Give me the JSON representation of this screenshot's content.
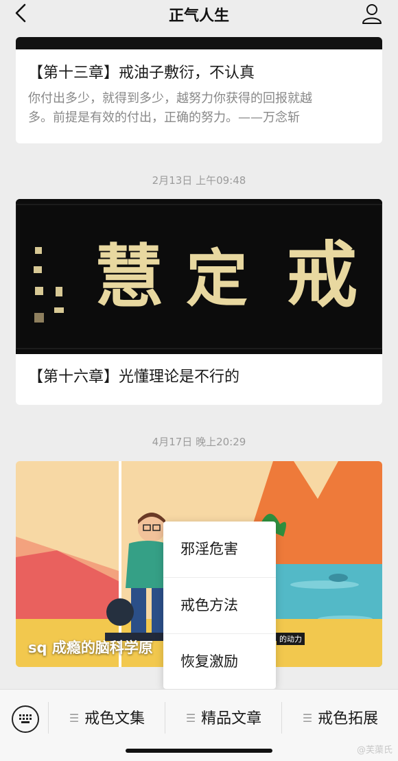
{
  "header": {
    "title": "正气人生",
    "back_icon": "chevron-left-icon",
    "profile_icon": "person-icon"
  },
  "articles": [
    {
      "title": "【第十三章】戒油子敷衍，不认真",
      "desc_line1": "你付出多少，就得到多少，越努力你获得的回报就越",
      "desc_line2": "多。前提是有效的付出，正确的努力。——万念斩"
    },
    {
      "timestamp": "2月13日 上午09:48",
      "title": "【第十六章】光懂理论是不行的",
      "image_text": [
        "戒",
        "定",
        "慧"
      ]
    },
    {
      "timestamp": "4月17日 晚上20:29",
      "overlay_title": "sq 成瘾的脑科学原",
      "subtitle": "的动力"
    }
  ],
  "popup_menu": {
    "items": [
      "邪淫危害",
      "戒色方法",
      "恢复激励"
    ]
  },
  "bottom_bar": {
    "keyboard_icon": "keyboard-icon",
    "menus": [
      "戒色文集",
      "精品文章",
      "戒色拓展"
    ]
  },
  "watermark": "@芙蕖氏",
  "colors": {
    "background": "#ededed",
    "card": "#ffffff",
    "text_primary": "#1a1a1a",
    "text_secondary": "#888888",
    "calligraphy_gold": "#e8d8a0"
  }
}
